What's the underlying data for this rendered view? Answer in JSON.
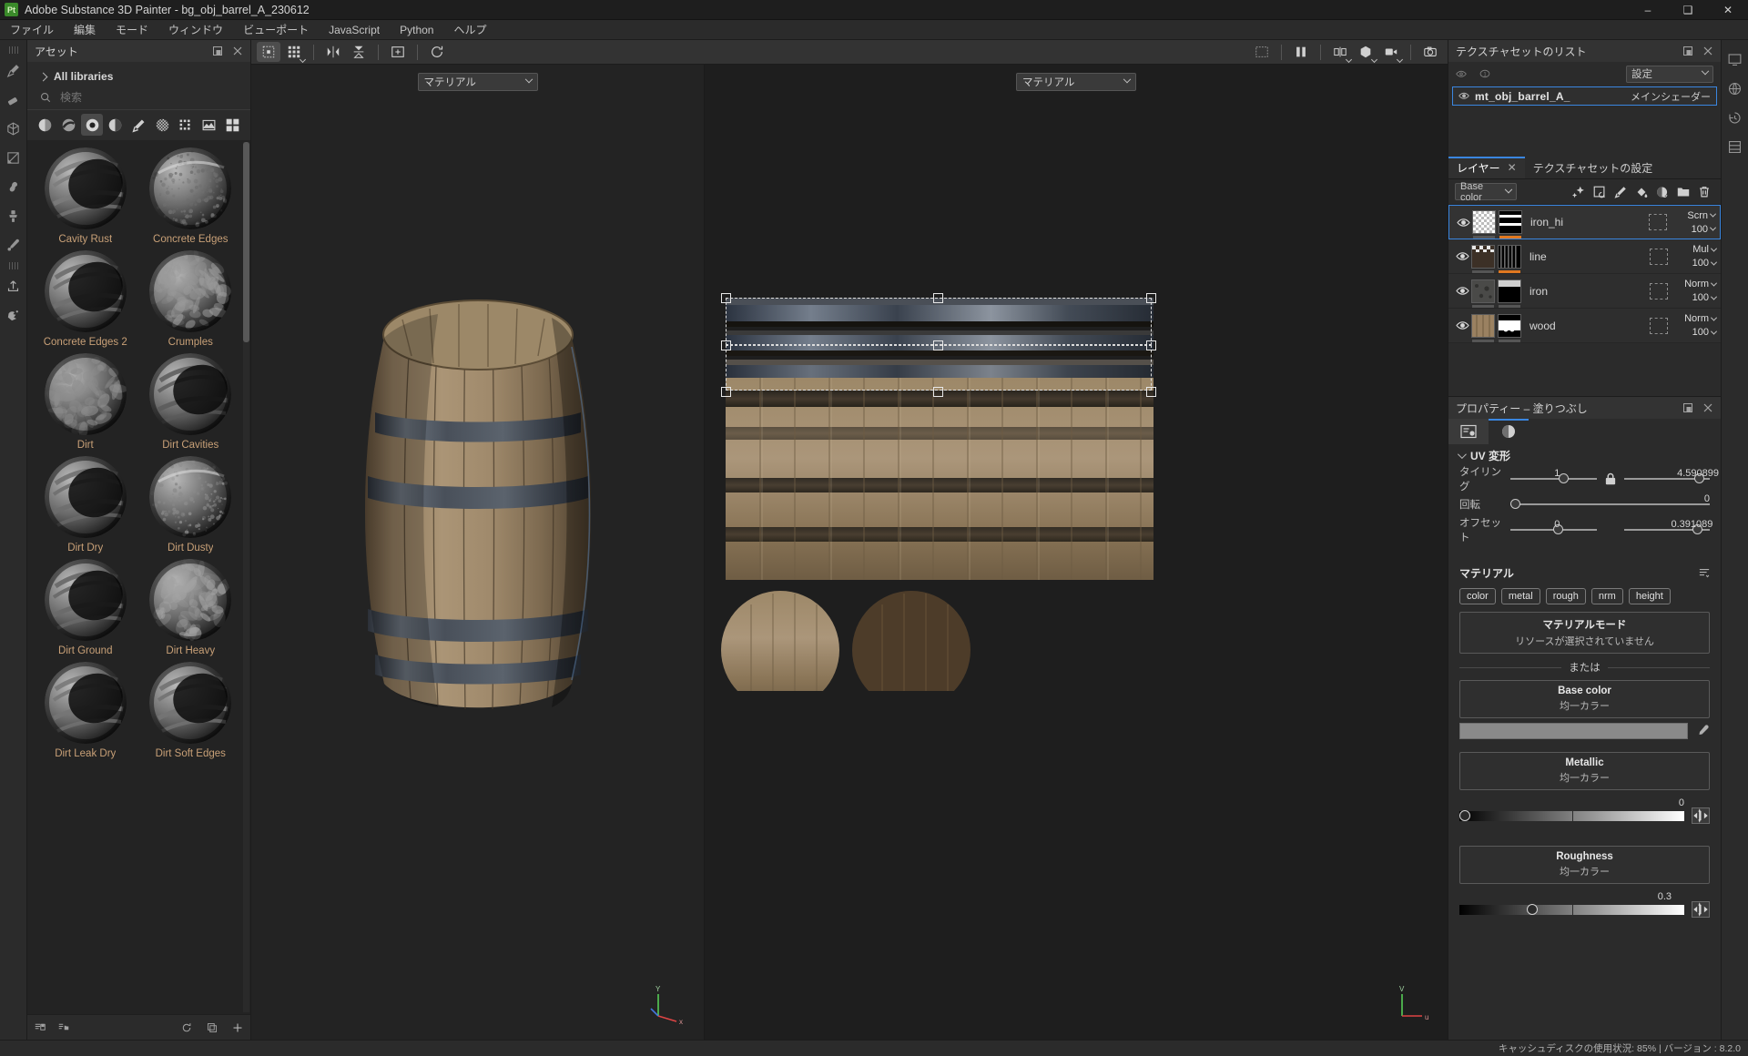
{
  "window": {
    "app_title": "Adobe Substance 3D Painter - bg_obj_barrel_A_230612",
    "logo_text": "Pt",
    "minimize": "–",
    "maximize": "❑",
    "close": "✕"
  },
  "menu": {
    "items": [
      {
        "label": "ファイル"
      },
      {
        "label": "編集"
      },
      {
        "label": "モード"
      },
      {
        "label": "ウィンドウ"
      },
      {
        "label": "ビューポート"
      },
      {
        "label": "JavaScript"
      },
      {
        "label": "Python"
      },
      {
        "label": "ヘルプ"
      }
    ]
  },
  "left_toolbar": {
    "tools": [
      {
        "name": "paint-brush-tool"
      },
      {
        "name": "eraser-tool"
      },
      {
        "name": "geometry-decal-tool"
      },
      {
        "name": "projection-tool"
      },
      {
        "name": "smudge-tool"
      },
      {
        "name": "clone-stamp-tool"
      },
      {
        "name": "color-picker-tool"
      },
      {
        "name": "export-tool"
      },
      {
        "name": "particles-tool"
      }
    ]
  },
  "assets": {
    "panel_title": "アセット",
    "library_label": "All libraries",
    "search_placeholder": "検索",
    "search_value": "",
    "filters": [
      {
        "name": "material-filter"
      },
      {
        "name": "smart-material-filter"
      },
      {
        "name": "smart-mask-filter"
      },
      {
        "name": "mask-generator-filter"
      },
      {
        "name": "brush-filter"
      },
      {
        "name": "alpha-filter"
      },
      {
        "name": "texture-filter"
      },
      {
        "name": "environment-filter"
      }
    ],
    "view_toggle": "grid-view-icon",
    "items": [
      {
        "label": "Cavity Rust",
        "kind": "rings",
        "tone": "#7d7d7d"
      },
      {
        "label": "Concrete Edges",
        "kind": "speck",
        "tone": "#6e6e6e"
      },
      {
        "label": "Concrete Edges 2",
        "kind": "rings2",
        "tone": "#707070"
      },
      {
        "label": "Crumples",
        "kind": "noise",
        "tone": "#9a9a9a"
      },
      {
        "label": "Dirt",
        "kind": "noise",
        "tone": "#8e8e8e"
      },
      {
        "label": "Dirt Cavities",
        "kind": "rings",
        "tone": "#5a5a5a"
      },
      {
        "label": "Dirt Dry",
        "kind": "rings",
        "tone": "#6d6d6d"
      },
      {
        "label": "Dirt Dusty",
        "kind": "speck",
        "tone": "#8a8a8a"
      },
      {
        "label": "Dirt Ground",
        "kind": "rings2",
        "tone": "#6a6a6a"
      },
      {
        "label": "Dirt Heavy",
        "kind": "noise",
        "tone": "#a3a3a3"
      },
      {
        "label": "Dirt Leak Dry",
        "kind": "rings",
        "tone": "#767676"
      },
      {
        "label": "Dirt Soft Edges",
        "kind": "rings2",
        "tone": "#747474"
      }
    ],
    "footer_icons": [
      {
        "name": "save-asset-icon"
      },
      {
        "name": "import-asset-icon"
      },
      {
        "name": "refresh-icon"
      },
      {
        "name": "duplicate-icon"
      },
      {
        "name": "add-icon"
      }
    ]
  },
  "viewport_toolbar": {
    "buttons": [
      {
        "name": "selection-mode-button",
        "active": true
      },
      {
        "name": "uv-tiles-button",
        "active": false
      },
      {
        "name": "symmetry-button",
        "active": false
      },
      {
        "name": "symmetry-plane-button",
        "active": false
      },
      {
        "name": "add-view-button",
        "active": false
      },
      {
        "name": "reload-button",
        "active": false
      }
    ],
    "right_buttons": [
      {
        "name": "hide-selection-button"
      },
      {
        "name": "split-view-button"
      },
      {
        "name": "view-mode-button"
      },
      {
        "name": "shading-mode-button"
      },
      {
        "name": "camera-button"
      },
      {
        "name": "screenshot-button"
      }
    ]
  },
  "viewports": {
    "left": {
      "combo_label": "マテリアル",
      "axis": {
        "x": "x",
        "y": "Y"
      }
    },
    "right": {
      "combo_label": "マテリアル",
      "axis": {
        "u": "u",
        "v": "V"
      }
    }
  },
  "right_rail": {
    "icons": [
      {
        "name": "display-settings-icon"
      },
      {
        "name": "environment-icon"
      },
      {
        "name": "history-icon"
      },
      {
        "name": "shelf-icon"
      }
    ]
  },
  "texture_set_list": {
    "panel_title": "テクスチャセットのリスト",
    "dock_icon": "dock-icon",
    "close_icon": "close-icon",
    "visibility_icon": "eye-toggle-icon",
    "info_icon": "info-icon",
    "settings_label": "設定",
    "sets": [
      {
        "name": "mt_obj_barrel_A_",
        "shader": "メインシェーダー",
        "selected": true
      }
    ]
  },
  "layers_panel": {
    "tabs": [
      {
        "label": "レイヤー",
        "active": true,
        "closable": true
      },
      {
        "label": "テクスチャセットの設定",
        "active": false,
        "closable": false
      }
    ],
    "channel_selector": "Base color",
    "tools": [
      {
        "name": "add-effect-icon"
      },
      {
        "name": "add-fill-layer-icon"
      },
      {
        "name": "add-paint-layer-icon"
      },
      {
        "name": "add-fill-icon"
      },
      {
        "name": "add-mask-icon"
      },
      {
        "name": "add-folder-icon"
      },
      {
        "name": "delete-layer-icon"
      }
    ],
    "layers": [
      {
        "name": "iron_hi",
        "blend": "Scrn",
        "opacity": "100",
        "selected": true,
        "thumb": "checker",
        "mask": "stripe-h",
        "maskbar": "#e07820"
      },
      {
        "name": "line",
        "blend": "Mul",
        "opacity": "100",
        "selected": false,
        "thumb": "checkerdark",
        "mask": "stripe-v",
        "maskbar": "#e07820"
      },
      {
        "name": "iron",
        "blend": "Norm",
        "opacity": "100",
        "selected": false,
        "thumb": "metal",
        "mask": "half",
        "maskbar": "#555555"
      },
      {
        "name": "wood",
        "blend": "Norm",
        "opacity": "100",
        "selected": false,
        "thumb": "wood",
        "mask": "dots",
        "maskbar": "#555555"
      }
    ]
  },
  "properties": {
    "panel_title": "プロパティー – 塗りつぶし",
    "dock_icon": "dock-icon",
    "close_icon": "close-icon",
    "tabs": [
      {
        "name": "properties-tab",
        "active": false
      },
      {
        "name": "material-tab",
        "active": true
      }
    ],
    "uv_transform": {
      "section_label": "UV 変形",
      "tiling_label": "タイリング",
      "tiling_u": "1",
      "tiling_v": "4.590899",
      "lock_icon": "lock-icon",
      "rotation_label": "回転",
      "rotation": "0",
      "offset_label": "オフセット",
      "offset_u": "0",
      "offset_v": "0.391089"
    },
    "material": {
      "section_label": "マテリアル",
      "menu_icon": "list-menu-icon",
      "channels": [
        {
          "label": "color"
        },
        {
          "label": "metal"
        },
        {
          "label": "rough"
        },
        {
          "label": "nrm"
        },
        {
          "label": "height"
        }
      ],
      "mode_title": "マテリアルモード",
      "mode_subtitle": "リソースが選択されていません",
      "or_label": "または",
      "base_color": {
        "title": "Base color",
        "subtitle": "均一カラー",
        "color": "#8a8a8a",
        "picker_icon": "eyedropper-icon"
      },
      "metallic": {
        "title": "Metallic",
        "subtitle": "均一カラー",
        "value": "0",
        "value_num": 0
      },
      "roughness": {
        "title": "Roughness",
        "subtitle": "均一カラー",
        "value": "0.3",
        "value_num": 0.3
      }
    }
  },
  "statusbar": {
    "text": "キャッシュディスクの使用状況:  85% | バージョン : 8.2.0"
  },
  "colors": {
    "accent": "#3a86e0",
    "asset_label": "#c8a077",
    "orange_bar": "#e07820",
    "panel_bg": "#2b2b2b"
  }
}
